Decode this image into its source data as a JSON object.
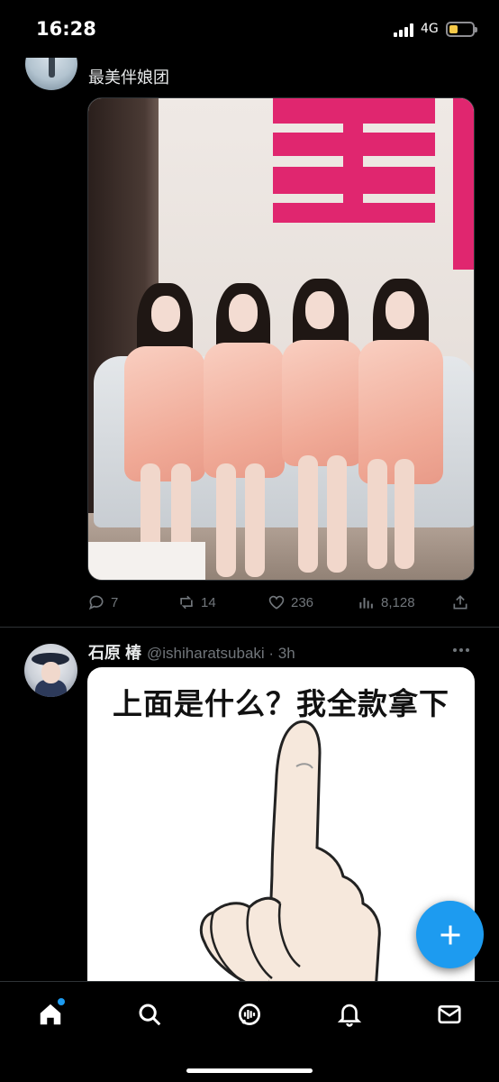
{
  "status_bar": {
    "time": "16:28",
    "network": "4G",
    "battery_color": "#f7c948"
  },
  "tweets": [
    {
      "text": "最美伴娘团",
      "media": {
        "description_icon": "photo",
        "wall_sign_color": "#e0266f"
      },
      "actions": {
        "replies": "7",
        "retweets": "14",
        "likes": "236",
        "views": "8,128"
      }
    },
    {
      "author_name": "石原 椿",
      "handle_time": "@ishiharatsubaki · 3h",
      "media": {
        "caption": "上面是什么？我全款拿下"
      }
    }
  ],
  "fab": {
    "icon": "plus-icon",
    "color": "#1d9bf0"
  },
  "bottom_nav": {
    "items": [
      "home-icon",
      "search-icon",
      "spaces-icon",
      "notifications-icon",
      "messages-icon"
    ],
    "accent": "#1d9bf0"
  }
}
